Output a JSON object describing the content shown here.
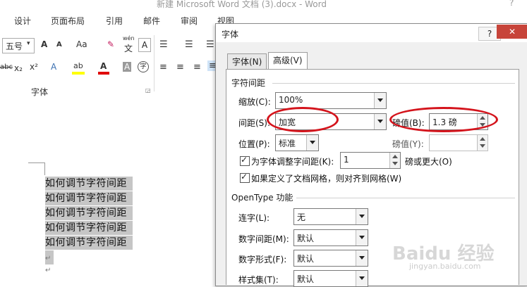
{
  "window": {
    "title": "新建 Microsoft Word 文档 (3).docx - Word",
    "help": "?"
  },
  "tabs": [
    "设计",
    "页面布局",
    "引用",
    "邮件",
    "审阅",
    "视图"
  ],
  "ribbon": {
    "font_size": "五号",
    "grow": "A",
    "shrink": "A",
    "case": "Aa",
    "phonetic_top": "wén",
    "phonetic": "文",
    "border_char": "A",
    "strike": "abc",
    "subscript": "x₂",
    "superscript": "x²",
    "highlight": "ab",
    "font_color": "A",
    "shade": "A",
    "enclose": "字",
    "group_label": "字体"
  },
  "document": {
    "lines": [
      "如何调节字符间距",
      "如何调节字符间距",
      "如何调节字符间距",
      "如何调节字符间距",
      "如何调节字符间距"
    ],
    "para_mark": "↵"
  },
  "dialog": {
    "title": "字体",
    "help": "?",
    "close": "✕",
    "tabs": [
      "字体(N)",
      "高级(V)"
    ],
    "active_tab": "高级(V)",
    "section_spacing": "字符间距",
    "scale_label": "缩放(C):",
    "scale_value": "100%",
    "spacing_label": "间距(S):",
    "spacing_value": "加宽",
    "by_label": "磅值(B):",
    "by_value": "1.3 磅",
    "position_label": "位置(P):",
    "position_value": "标准",
    "pos_by_label": "磅值(Y):",
    "kerning_label": "为字体调整字间距(K):",
    "kerning_value": "1",
    "kerning_suffix": "磅或更大(O)",
    "grid_label": "如果定义了文档网格，则对齐到网格(W)",
    "section_opentype": "OpenType 功能",
    "ligatures_label": "连字(L):",
    "ligatures_value": "无",
    "num_spacing_label": "数字间距(M):",
    "num_spacing_value": "默认",
    "num_forms_label": "数字形式(F):",
    "num_forms_value": "默认",
    "stylistic_label": "样式集(T):",
    "stylistic_value": "默认"
  },
  "watermark": {
    "text": "Baidu 经验",
    "sub": "jingyan.baidu.com"
  },
  "colors": {
    "annotation": "#d4141c",
    "selection": "#c6c6c6",
    "close_button": "#c7443a"
  }
}
